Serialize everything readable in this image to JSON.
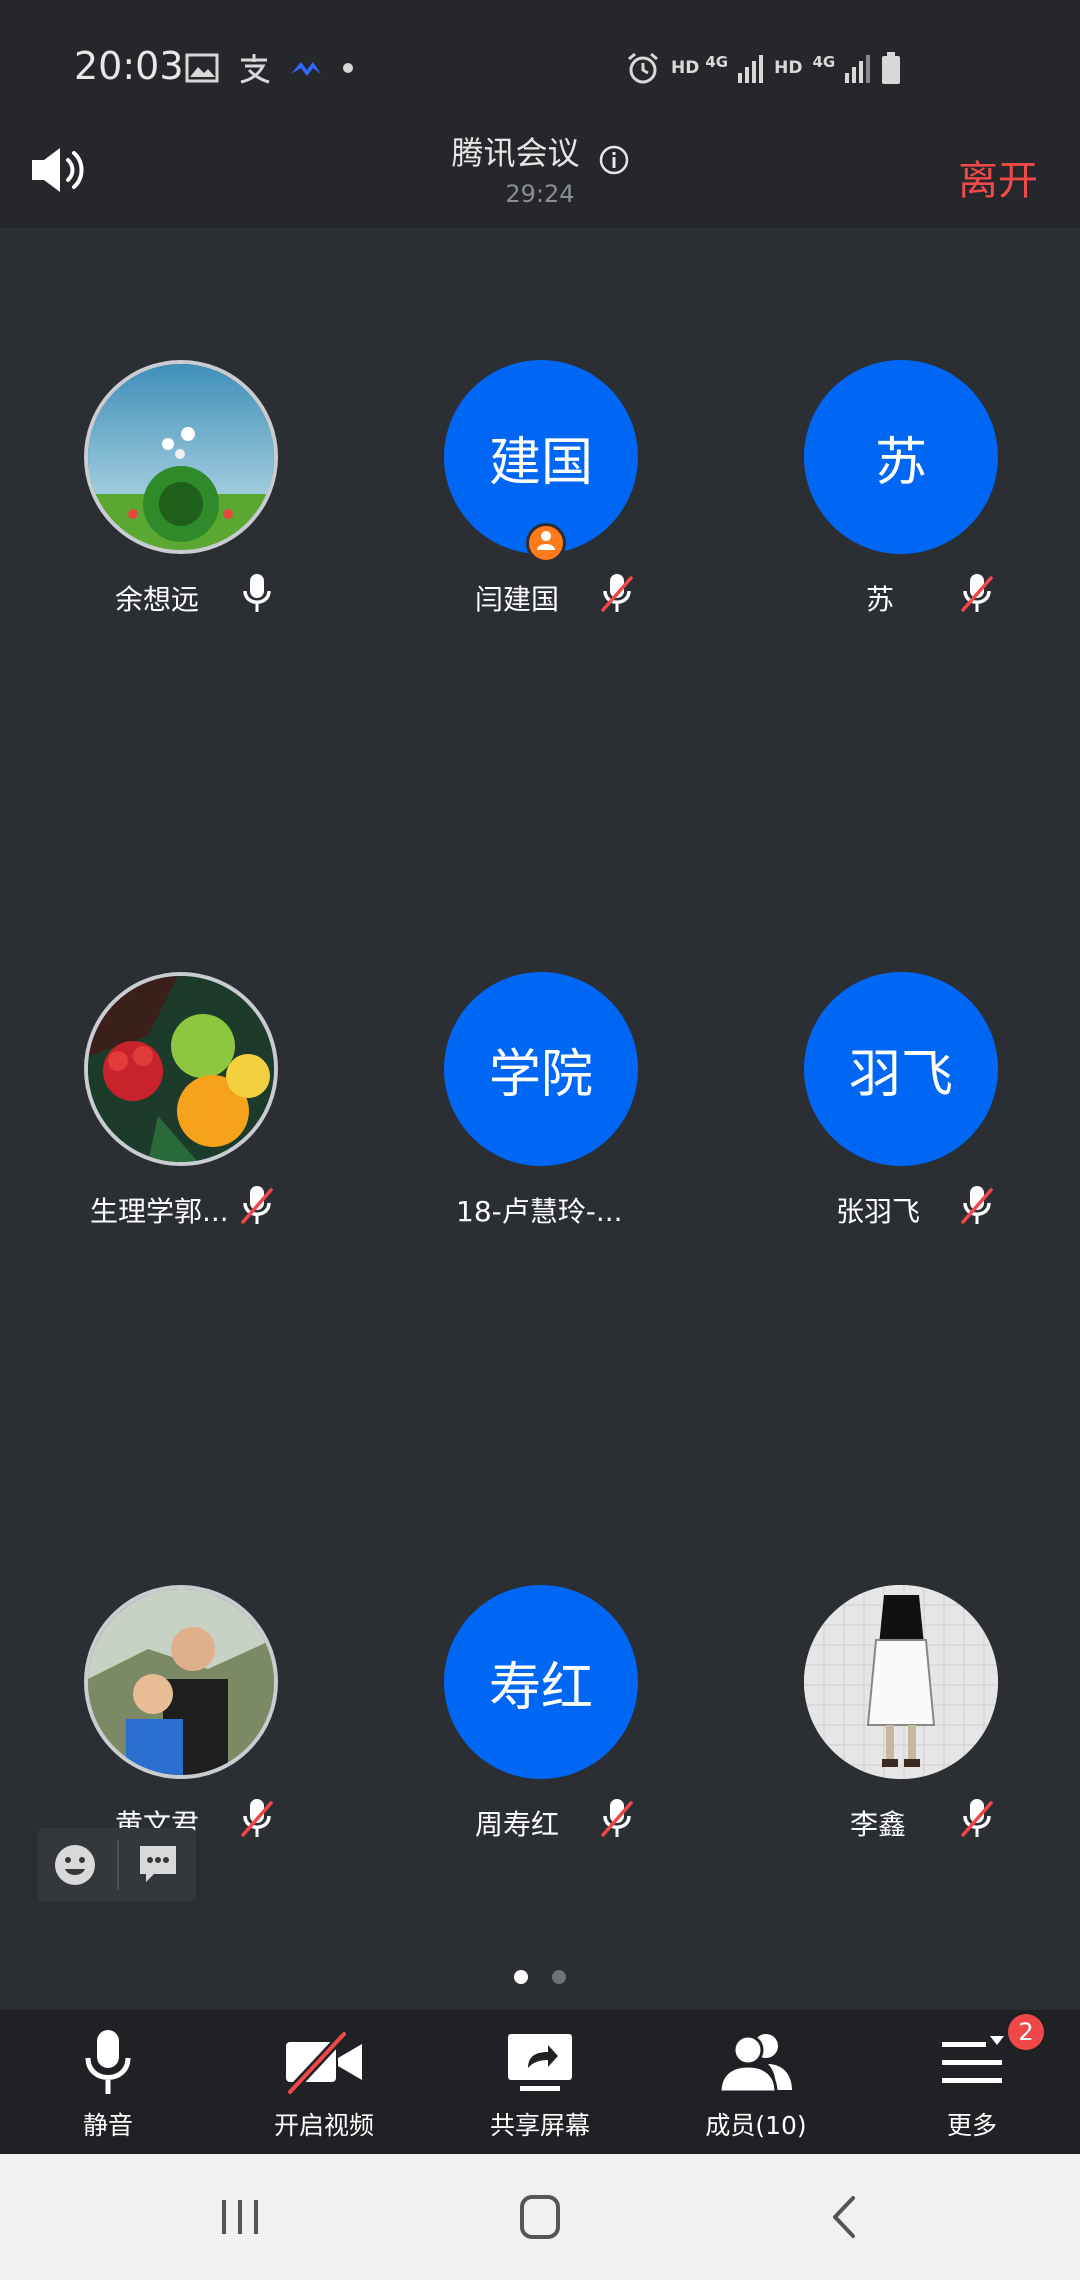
{
  "status_bar": {
    "time": "20:03",
    "icons_left": [
      "image-icon",
      "alipay-icon",
      "feishu-icon",
      "dot-icon"
    ],
    "hd1": "HD",
    "net1": "4G",
    "hd2": "HD",
    "net2": "4G"
  },
  "header": {
    "title": "腾讯会议",
    "timer": "29:24",
    "leave_label": "离开"
  },
  "participants": [
    {
      "name": "余想远",
      "avatar_type": "photo",
      "initials": "",
      "mic": "on",
      "host": false
    },
    {
      "name": "闫建国",
      "avatar_type": "initials",
      "initials": "建国",
      "mic": "muted",
      "host": true
    },
    {
      "name": "苏",
      "avatar_type": "initials",
      "initials": "苏",
      "mic": "muted",
      "host": false
    },
    {
      "name": "生理学郭...",
      "avatar_type": "photo",
      "initials": "",
      "mic": "muted",
      "host": false
    },
    {
      "name": "18-卢慧玲-...",
      "avatar_type": "initials",
      "initials": "学院",
      "mic": "none",
      "host": false
    },
    {
      "name": "张羽飞",
      "avatar_type": "initials",
      "initials": "羽飞",
      "mic": "muted",
      "host": false
    },
    {
      "name": "黄文君",
      "avatar_type": "photo",
      "initials": "",
      "mic": "muted",
      "host": false
    },
    {
      "name": "周寿红",
      "avatar_type": "initials",
      "initials": "寿红",
      "mic": "muted",
      "host": false
    },
    {
      "name": "李鑫",
      "avatar_type": "photo",
      "initials": "",
      "mic": "muted",
      "host": false
    }
  ],
  "pagination": {
    "total": 2,
    "current": 1
  },
  "toolbar": {
    "mute_label": "静音",
    "video_label": "开启视频",
    "share_label": "共享屏幕",
    "members_label": "成员(10)",
    "more_label": "更多",
    "more_badge": "2"
  },
  "colors": {
    "background": "#2b2e33",
    "avatar_blue": "#0067f5",
    "leave_red": "#f24a4a",
    "muted_red": "#f04848",
    "host_orange": "#ff7a1a"
  }
}
